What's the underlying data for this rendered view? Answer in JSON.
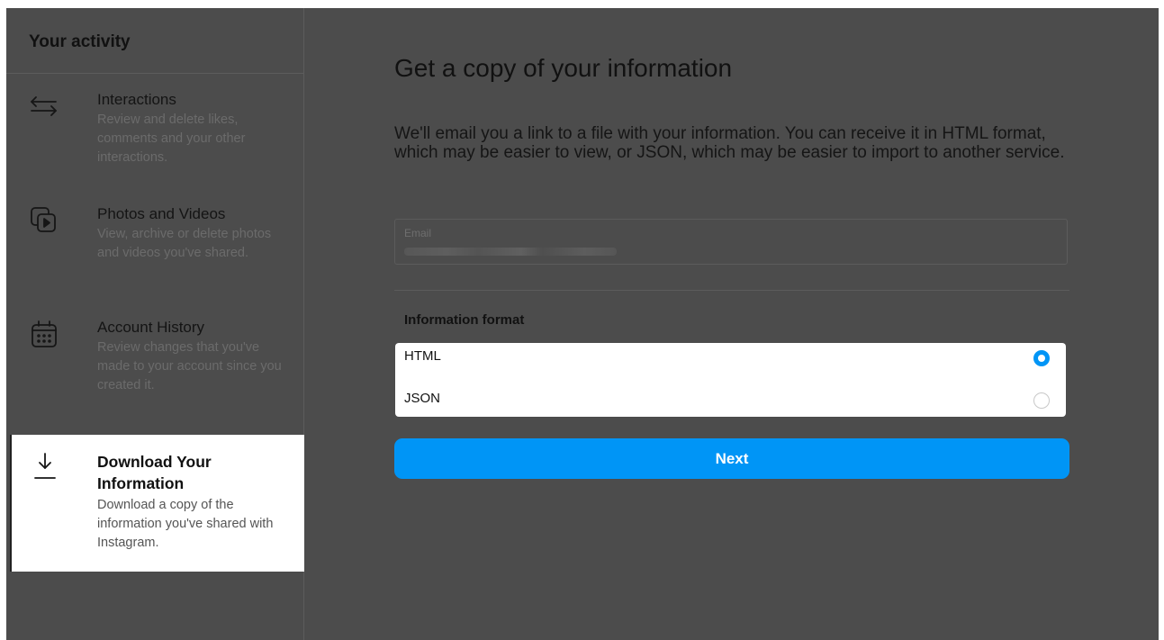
{
  "sidebar": {
    "header": "Your activity",
    "items": [
      {
        "title": "Interactions",
        "description": "Review and delete likes, comments and your other interactions.",
        "icon": "interactions-arrows-icon"
      },
      {
        "title": "Photos and Videos",
        "description": "View, archive or delete photos and videos you've shared.",
        "icon": "photos-videos-icon"
      },
      {
        "title": "Account History",
        "description": "Review changes that you've made to your account since you created it.",
        "icon": "calendar-icon"
      },
      {
        "title": "Download Your Information",
        "description": "Download a copy of the information you've shared with Instagram.",
        "icon": "download-icon",
        "active": true
      }
    ]
  },
  "main": {
    "title": "Get a copy of your information",
    "intro": "We'll email you a link to a file with your information. You can receive it in HTML format, which may be easier to view, or JSON, which may be easier to import to another service.",
    "email": {
      "label": "Email"
    },
    "format": {
      "label": "Information format",
      "options": [
        {
          "label": "HTML",
          "selected": true
        },
        {
          "label": "JSON",
          "selected": false
        }
      ]
    },
    "next_label": "Next"
  },
  "colors": {
    "accent": "#0095f6",
    "overlay": "#4c4c4c"
  }
}
